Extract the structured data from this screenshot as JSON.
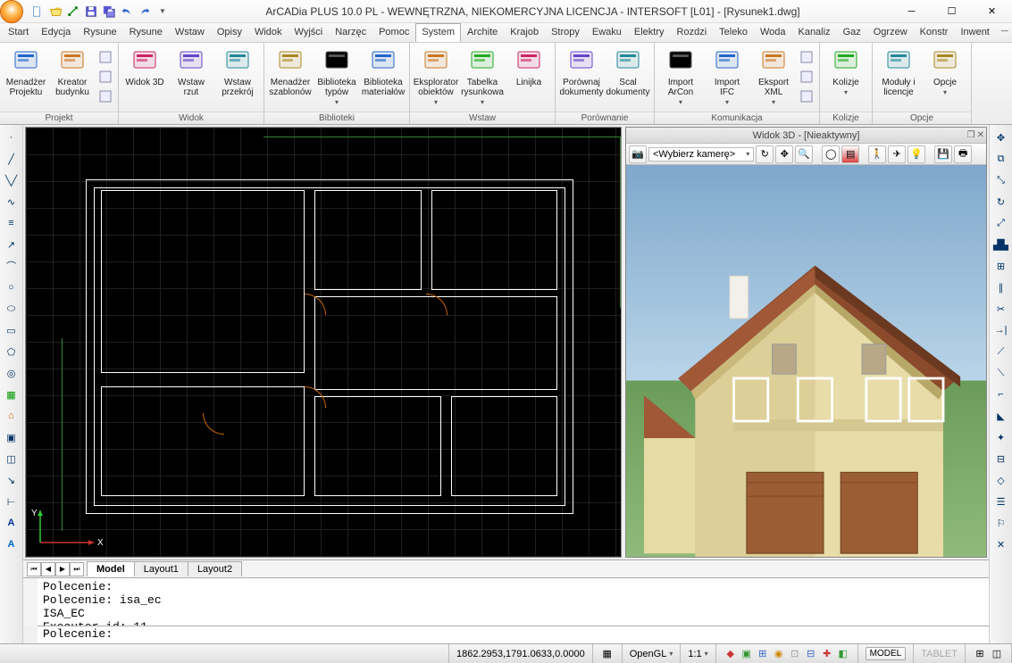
{
  "title": "ArCADia PLUS 10.0 PL - WEWNĘTRZNA, NIEKOMERCYJNA LICENCJA - INTERSOFT [L01] - [Rysunek1.dwg]",
  "menus": [
    "Start",
    "Edycja",
    "Rysune",
    "Rysune",
    "Wstaw",
    "Opisy",
    "Widok",
    "Wyjści",
    "Narzęc",
    "Pomoc",
    "System",
    "Archite",
    "Krajob",
    "Stropy",
    "Ewaku",
    "Elektry",
    "Rozdzi",
    "Teleko",
    "Woda",
    "Kanaliz",
    "Gaz",
    "Ogrzew",
    "Konstr",
    "Inwent"
  ],
  "active_menu_index": 10,
  "ribbon": [
    {
      "title": "Projekt",
      "items": [
        {
          "label": "Menadżer Projektu"
        },
        {
          "label": "Kreator budynku"
        }
      ],
      "has_small": true
    },
    {
      "title": "Widok",
      "items": [
        {
          "label": "Widok 3D"
        },
        {
          "label": "Wstaw rzut"
        },
        {
          "label": "Wstaw przekrój"
        }
      ]
    },
    {
      "title": "Biblioteki",
      "items": [
        {
          "label": "Menadżer szablonów"
        },
        {
          "label": "Biblioteka typów",
          "drop": true
        },
        {
          "label": "Biblioteka materiałów"
        }
      ]
    },
    {
      "title": "Wstaw",
      "items": [
        {
          "label": "Eksplorator obiektów",
          "drop": true
        },
        {
          "label": "Tabelka rysunkowa",
          "drop": true
        },
        {
          "label": "Linijka"
        }
      ]
    },
    {
      "title": "Porównanie",
      "items": [
        {
          "label": "Porównaj dokumenty"
        },
        {
          "label": "Scal dokumenty"
        }
      ]
    },
    {
      "title": "Komunikacja",
      "items": [
        {
          "label": "Import ArCon",
          "drop": true
        },
        {
          "label": "Import IFC",
          "drop": true
        },
        {
          "label": "Eksport XML",
          "drop": true
        }
      ],
      "has_small": true
    },
    {
      "title": "Kolizje",
      "items": [
        {
          "label": "Kolizje",
          "drop": true
        }
      ]
    },
    {
      "title": "Opcje",
      "items": [
        {
          "label": "Moduły i licencje"
        },
        {
          "label": "Opcje",
          "drop": true
        }
      ]
    }
  ],
  "view3d": {
    "title": "Widok 3D - [Nieaktywny]",
    "camera": "<Wybierz kamerę>"
  },
  "tabs": {
    "items": [
      "Model",
      "Layout1",
      "Layout2"
    ],
    "active": 0
  },
  "cmd_history": "Polecenie:\nPolecenie: isa_ec\nISA_EC\nExecutor id: 11",
  "cmd_prompt": "Polecenie:",
  "status": {
    "coords": "1862.2953,1791.0633,0.0000",
    "renderer": "OpenGL",
    "scale": "1:1",
    "model_label": "MODEL",
    "tablet_label": "TABLET"
  }
}
